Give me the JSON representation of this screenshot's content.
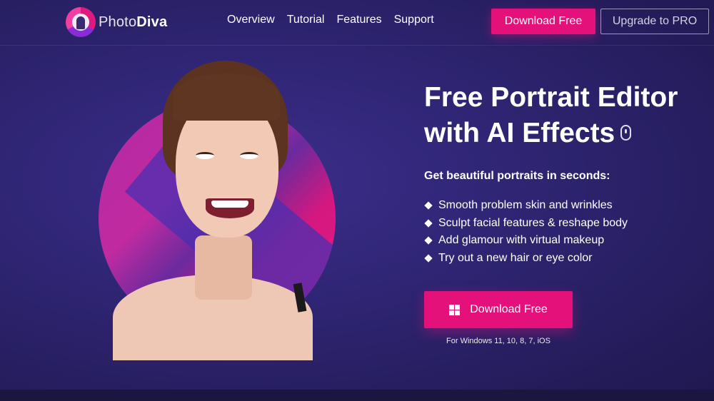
{
  "brand": {
    "logo_text_prefix": "Photo",
    "logo_text_suffix": "Diva"
  },
  "nav": {
    "items": [
      {
        "label": "Overview"
      },
      {
        "label": "Tutorial"
      },
      {
        "label": "Features"
      },
      {
        "label": "Support"
      }
    ]
  },
  "header": {
    "download_label": "Download Free",
    "upgrade_label": "Upgrade to PRO"
  },
  "hero": {
    "title_line1": "Free Portrait Editor",
    "title_line2": "with AI Effects",
    "subtitle": "Get beautiful portraits in seconds:",
    "features": [
      "Smooth problem skin and wrinkles",
      "Sculpt facial features & reshape body",
      "Add glamour with virtual makeup",
      "Try out a new hair or eye color"
    ],
    "download_label": "Download Free",
    "platforms": "For Windows 11, 10, 8, 7, iOS"
  },
  "icons": {
    "logo": "photodiva-logo-icon",
    "scroll": "mouse-scroll-icon",
    "bullet": "diamond-bullet-icon",
    "windows": "windows-icon"
  },
  "colors": {
    "background": "#2f2574",
    "accent": "#e4117a",
    "text": "#ffffff"
  }
}
